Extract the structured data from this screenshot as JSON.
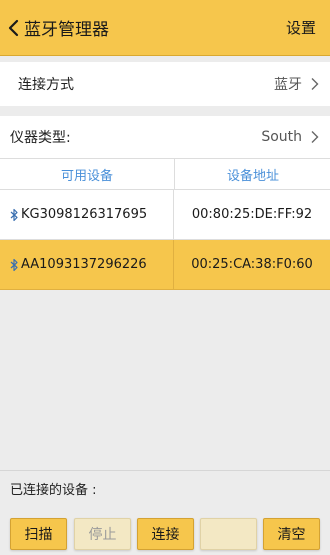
{
  "header": {
    "title": "蓝牙管理器",
    "settings_label": "设置"
  },
  "connection": {
    "label": "连接方式",
    "value": "蓝牙"
  },
  "instrument": {
    "label": "仪器类型:",
    "value": "South"
  },
  "devices": {
    "col_name": "可用设备",
    "col_address": "设备地址",
    "rows": [
      {
        "name": "KG3098126317695",
        "address": "00:80:25:DE:FF:92",
        "selected": false
      },
      {
        "name": "AA1093137296226",
        "address": "00:25:CA:38:F0:60",
        "selected": true
      }
    ]
  },
  "connected_label": "已连接的设备 :",
  "buttons": {
    "scan": "扫描",
    "stop": "停止",
    "connect": "连接",
    "disconnect": "",
    "clear": "清空"
  },
  "colors": {
    "accent": "#f6c64c",
    "header_text": "#1a1a1a",
    "column_header": "#4a90d9",
    "bluetooth_icon": "#3a6fb0"
  },
  "icons": {
    "back": "chevron-left-icon",
    "row_arrow": "chevron-right-icon",
    "bluetooth": "bluetooth-icon"
  }
}
